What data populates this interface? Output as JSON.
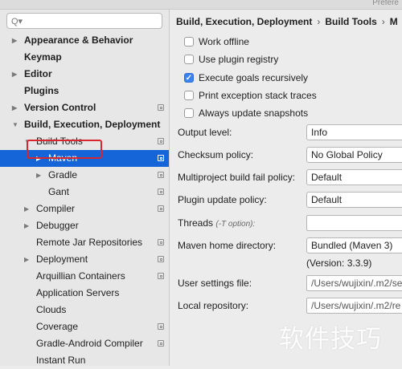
{
  "window": {
    "title": "Prefere"
  },
  "search": {
    "placeholder": "",
    "icon": "search-icon"
  },
  "tree": [
    {
      "id": "appearance",
      "label": "Appearance & Behavior",
      "bold": true,
      "indent": 0,
      "arrow": "▶",
      "proj": false
    },
    {
      "id": "keymap",
      "label": "Keymap",
      "bold": true,
      "indent": 0,
      "arrow": "",
      "proj": false
    },
    {
      "id": "editor",
      "label": "Editor",
      "bold": true,
      "indent": 0,
      "arrow": "▶",
      "proj": false
    },
    {
      "id": "plugins",
      "label": "Plugins",
      "bold": true,
      "indent": 0,
      "arrow": "",
      "proj": false
    },
    {
      "id": "version-control",
      "label": "Version Control",
      "bold": true,
      "indent": 0,
      "arrow": "▶",
      "proj": true
    },
    {
      "id": "build-exec-deploy",
      "label": "Build, Execution, Deployment",
      "bold": true,
      "indent": 0,
      "arrow": "▼",
      "proj": false
    },
    {
      "id": "build-tools",
      "label": "Build Tools",
      "bold": false,
      "indent": 1,
      "arrow": "▼",
      "proj": true
    },
    {
      "id": "maven",
      "label": "Maven",
      "bold": false,
      "indent": 2,
      "arrow": "▶",
      "proj": true,
      "selected": true
    },
    {
      "id": "gradle",
      "label": "Gradle",
      "bold": false,
      "indent": 2,
      "arrow": "▶",
      "proj": true
    },
    {
      "id": "gant",
      "label": "Gant",
      "bold": false,
      "indent": 2,
      "arrow": "",
      "proj": true
    },
    {
      "id": "compiler",
      "label": "Compiler",
      "bold": false,
      "indent": 1,
      "arrow": "▶",
      "proj": true
    },
    {
      "id": "debugger",
      "label": "Debugger",
      "bold": false,
      "indent": 1,
      "arrow": "▶",
      "proj": false
    },
    {
      "id": "remote-jar",
      "label": "Remote Jar Repositories",
      "bold": false,
      "indent": 1,
      "arrow": "",
      "proj": true
    },
    {
      "id": "deployment",
      "label": "Deployment",
      "bold": false,
      "indent": 1,
      "arrow": "▶",
      "proj": true
    },
    {
      "id": "arquillian",
      "label": "Arquillian Containers",
      "bold": false,
      "indent": 1,
      "arrow": "",
      "proj": true
    },
    {
      "id": "app-servers",
      "label": "Application Servers",
      "bold": false,
      "indent": 1,
      "arrow": "",
      "proj": false
    },
    {
      "id": "clouds",
      "label": "Clouds",
      "bold": false,
      "indent": 1,
      "arrow": "",
      "proj": false
    },
    {
      "id": "coverage",
      "label": "Coverage",
      "bold": false,
      "indent": 1,
      "arrow": "",
      "proj": true
    },
    {
      "id": "gradle-android",
      "label": "Gradle-Android Compiler",
      "bold": false,
      "indent": 1,
      "arrow": "",
      "proj": true
    },
    {
      "id": "instant-run",
      "label": "Instant Run",
      "bold": false,
      "indent": 1,
      "arrow": "",
      "proj": false
    }
  ],
  "breadcrumb": {
    "part1": "Build, Execution, Deployment",
    "sep": "›",
    "part2": "Build Tools",
    "part3": "M"
  },
  "checkboxes": [
    {
      "id": "work-offline",
      "label": "Work offline",
      "checked": false
    },
    {
      "id": "plugin-registry",
      "label": "Use plugin registry",
      "checked": false
    },
    {
      "id": "exec-goals",
      "label": "Execute goals recursively",
      "checked": true
    },
    {
      "id": "print-traces",
      "label": "Print exception stack traces",
      "checked": false
    },
    {
      "id": "update-snapshots",
      "label": "Always update snapshots",
      "checked": false
    }
  ],
  "settings": {
    "output_level": {
      "label": "Output level:",
      "value": "Info"
    },
    "checksum": {
      "label": "Checksum policy:",
      "value": "No Global Policy"
    },
    "multiproject": {
      "label": "Multiproject build fail policy:",
      "value": "Default"
    },
    "plugin_update": {
      "label": "Plugin update policy:",
      "value": "Default"
    },
    "threads": {
      "label": "Threads",
      "hint": "(-T option):",
      "value": ""
    },
    "maven_home": {
      "label": "Maven home directory:",
      "value": "Bundled (Maven 3)",
      "version": "(Version: 3.3.9)"
    },
    "user_settings": {
      "label": "User settings file:",
      "value": "/Users/wujixin/.m2/se"
    },
    "local_repo": {
      "label": "Local repository:",
      "value": "/Users/wujixin/.m2/re"
    }
  },
  "watermark": "软件技巧",
  "colors": {
    "selection": "#1665d8",
    "highlight_box": "#d8262f",
    "checkbox_on": "#3b84f0"
  }
}
